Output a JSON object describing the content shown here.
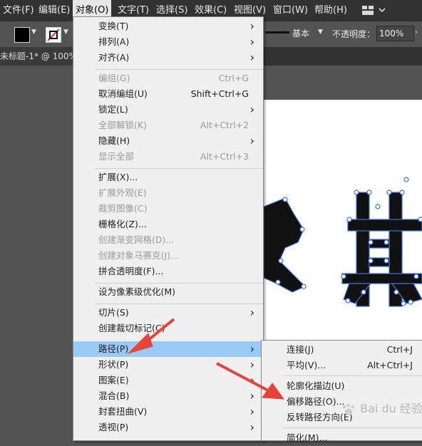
{
  "menubar": {
    "items": [
      {
        "label": "文件(F)"
      },
      {
        "label": "编辑(E)"
      },
      {
        "label": "对象(O)"
      },
      {
        "label": "文字(T)"
      },
      {
        "label": "选择(S)"
      },
      {
        "label": "效果(C)"
      },
      {
        "label": "视图(V)"
      },
      {
        "label": "窗口(W)"
      },
      {
        "label": "帮助(H)"
      }
    ]
  },
  "toolbar": {
    "stroke_label": "基本",
    "opacity_label": "不透明度：",
    "opacity_value": "100%"
  },
  "document_tab": {
    "title": "未标题-1* @ 100%"
  },
  "object_menu": {
    "items": [
      {
        "label": "变换(T)",
        "shortcut": "",
        "submenu": true,
        "disabled": false
      },
      {
        "label": "排列(A)",
        "shortcut": "",
        "submenu": true,
        "disabled": false
      },
      {
        "label": "对齐(A)",
        "shortcut": "",
        "submenu": true,
        "disabled": false
      },
      {
        "label": "编组(G)",
        "shortcut": "Ctrl+G",
        "submenu": false,
        "disabled": true
      },
      {
        "label": "取消编组(U)",
        "shortcut": "Shift+Ctrl+G",
        "submenu": false,
        "disabled": false
      },
      {
        "label": "锁定(L)",
        "shortcut": "",
        "submenu": true,
        "disabled": false
      },
      {
        "label": "全部解锁(K)",
        "shortcut": "Alt+Ctrl+2",
        "submenu": false,
        "disabled": true
      },
      {
        "label": "隐藏(H)",
        "shortcut": "",
        "submenu": true,
        "disabled": false
      },
      {
        "label": "显示全部",
        "shortcut": "Alt+Ctrl+3",
        "submenu": false,
        "disabled": true
      },
      {
        "label": "扩展(X)...",
        "shortcut": "",
        "submenu": false,
        "disabled": false
      },
      {
        "label": "扩展外观(E)",
        "shortcut": "",
        "submenu": false,
        "disabled": true
      },
      {
        "label": "裁剪图像(C)",
        "shortcut": "",
        "submenu": false,
        "disabled": true
      },
      {
        "label": "栅格化(Z)...",
        "shortcut": "",
        "submenu": false,
        "disabled": false
      },
      {
        "label": "创建渐变网格(D)...",
        "shortcut": "",
        "submenu": false,
        "disabled": true
      },
      {
        "label": "创建对象马赛克(J)...",
        "shortcut": "",
        "submenu": false,
        "disabled": true
      },
      {
        "label": "拼合透明度(F)...",
        "shortcut": "",
        "submenu": false,
        "disabled": false
      },
      {
        "label": "设为像素级优化(M)",
        "shortcut": "",
        "submenu": false,
        "disabled": false
      },
      {
        "label": "切片(S)",
        "shortcut": "",
        "submenu": true,
        "disabled": false
      },
      {
        "label": "创建裁切标记(C)",
        "shortcut": "",
        "submenu": false,
        "disabled": false
      },
      {
        "label": "路径(P)",
        "shortcut": "",
        "submenu": true,
        "disabled": false,
        "highlighted": true
      },
      {
        "label": "形状(P)",
        "shortcut": "",
        "submenu": true,
        "disabled": false
      },
      {
        "label": "图案(E)",
        "shortcut": "",
        "submenu": true,
        "disabled": false
      },
      {
        "label": "混合(B)",
        "shortcut": "",
        "submenu": true,
        "disabled": false
      },
      {
        "label": "封套扭曲(V)",
        "shortcut": "",
        "submenu": true,
        "disabled": false
      },
      {
        "label": "透视(P)",
        "shortcut": "",
        "submenu": true,
        "disabled": false
      }
    ]
  },
  "path_submenu": {
    "items": [
      {
        "label": "连接(J)",
        "shortcut": "Ctrl+J"
      },
      {
        "label": "平均(V)...",
        "shortcut": "Alt+Ctrl+J"
      },
      {
        "label": "轮廓化描边(U)",
        "shortcut": ""
      },
      {
        "label": "偏移路径(O)...",
        "shortcut": ""
      },
      {
        "label": "反转路径方向(E)",
        "shortcut": ""
      },
      {
        "label": "简化(M)...",
        "shortcut": ""
      }
    ]
  },
  "watermark": {
    "text": "Bai du 经验"
  },
  "colors": {
    "menubar_bg": "#323232",
    "menu_bg": "#f0f0f0",
    "highlight": "#99c9f5",
    "annotation_arrow": "#e8433b",
    "anchor_blue": "#3c6fd6",
    "glyph_fill": "#111111"
  }
}
